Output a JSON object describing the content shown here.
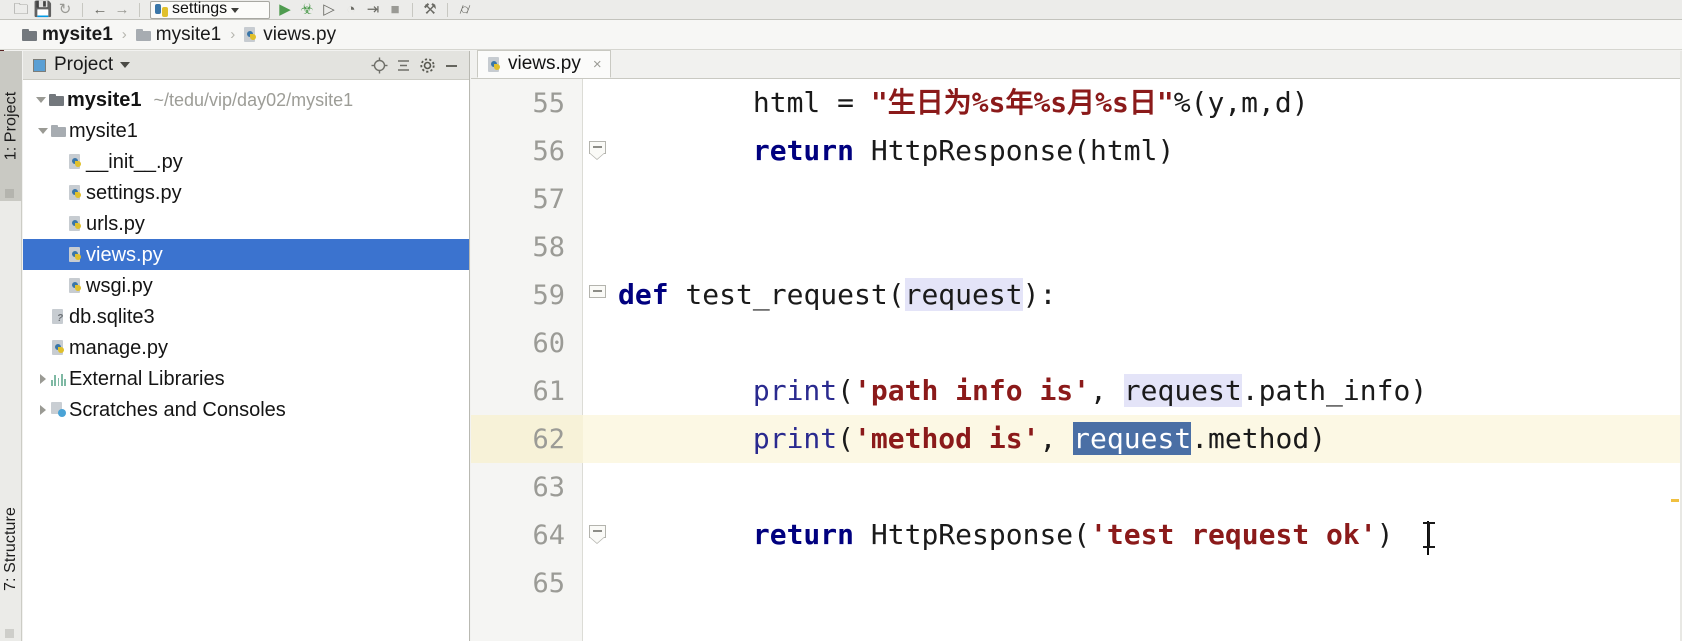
{
  "toolbar": {
    "icons": [
      {
        "name": "open-folder-icon",
        "glyph": "▭"
      },
      {
        "name": "save-all-icon",
        "glyph": "▣"
      },
      {
        "name": "sync-icon",
        "glyph": "↻"
      },
      {
        "name": "back-icon",
        "glyph": "←"
      },
      {
        "name": "forward-icon",
        "glyph": "→"
      }
    ],
    "run_config": {
      "label": "settings",
      "icon": "python-config-icon"
    },
    "run_icons": [
      {
        "name": "run-icon",
        "glyph": "▶"
      },
      {
        "name": "debug-icon",
        "glyph": "☣"
      },
      {
        "name": "run-coverage-icon",
        "glyph": "▷"
      },
      {
        "name": "profile-icon",
        "glyph": "◔"
      },
      {
        "name": "run-with-console-icon",
        "glyph": "⇥"
      },
      {
        "name": "stop-icon",
        "glyph": "■"
      },
      {
        "name": "build-icon",
        "glyph": "⚒"
      },
      {
        "name": "search-icon",
        "glyph": "⌕"
      }
    ]
  },
  "breadcrumb": {
    "items": [
      {
        "label": "mysite1",
        "icon": "folder-icon",
        "bold": true
      },
      {
        "label": "mysite1",
        "icon": "folder-icon-light",
        "bold": false
      },
      {
        "label": "views.py",
        "icon": "python-file-icon",
        "bold": false
      }
    ],
    "separator": "›"
  },
  "left_strip": {
    "project_tab": "1: Project",
    "structure_tab": "7: Structure"
  },
  "project_panel": {
    "title": "Project",
    "header_icons": [
      {
        "name": "locate-target-icon"
      },
      {
        "name": "collapse-all-icon"
      },
      {
        "name": "settings-gear-icon"
      },
      {
        "name": "hide-panel-icon"
      }
    ],
    "tree": [
      {
        "label": "mysite1",
        "path": "~/tedu/vip/day02/mysite1",
        "icon": "folder-icon",
        "arrow": "down",
        "indent": 0,
        "bold": true,
        "selected": false
      },
      {
        "label": "mysite1",
        "path": "",
        "icon": "folder-icon-light",
        "arrow": "down",
        "indent": 1,
        "bold": false,
        "selected": false
      },
      {
        "label": "__init__.py",
        "path": "",
        "icon": "python-file-icon",
        "arrow": "none",
        "indent": 3,
        "bold": false,
        "selected": false
      },
      {
        "label": "settings.py",
        "path": "",
        "icon": "python-file-icon",
        "arrow": "none",
        "indent": 3,
        "bold": false,
        "selected": false
      },
      {
        "label": "urls.py",
        "path": "",
        "icon": "python-file-icon",
        "arrow": "none",
        "indent": 3,
        "bold": false,
        "selected": false
      },
      {
        "label": "views.py",
        "path": "",
        "icon": "python-file-icon",
        "arrow": "none",
        "indent": 3,
        "bold": false,
        "selected": true
      },
      {
        "label": "wsgi.py",
        "path": "",
        "icon": "python-file-icon",
        "arrow": "none",
        "indent": 3,
        "bold": false,
        "selected": false
      },
      {
        "label": "db.sqlite3",
        "path": "",
        "icon": "database-file-icon",
        "arrow": "none",
        "indent": 2,
        "bold": false,
        "selected": false
      },
      {
        "label": "manage.py",
        "path": "",
        "icon": "python-file-icon",
        "arrow": "none",
        "indent": 2,
        "bold": false,
        "selected": false
      },
      {
        "label": "External Libraries",
        "path": "",
        "icon": "library-icon",
        "arrow": "right",
        "indent": 1,
        "bold": false,
        "selected": false
      },
      {
        "label": "Scratches and Consoles",
        "path": "",
        "icon": "scratch-icon",
        "arrow": "right",
        "indent": 1,
        "bold": false,
        "selected": false
      }
    ]
  },
  "editor": {
    "tab": {
      "label": "views.py",
      "icon": "python-file-icon",
      "close": "×"
    },
    "lines": [
      {
        "number": "55",
        "fold": "none",
        "highlight": false,
        "tokens": [
          {
            "t": "        ",
            "c": "plain"
          },
          {
            "t": "html",
            "c": "plain"
          },
          {
            "t": " = ",
            "c": "plain"
          },
          {
            "t": "\"生日为%s年%s月%s日\"",
            "c": "str"
          },
          {
            "t": "%(y,m,d)",
            "c": "plain"
          }
        ]
      },
      {
        "number": "56",
        "fold": "square",
        "highlight": false,
        "tokens": [
          {
            "t": "        ",
            "c": "plain"
          },
          {
            "t": "return",
            "c": "kw"
          },
          {
            "t": " HttpResponse(html)",
            "c": "plain"
          }
        ]
      },
      {
        "number": "57",
        "fold": "none",
        "highlight": false,
        "tokens": []
      },
      {
        "number": "58",
        "fold": "none",
        "highlight": false,
        "tokens": []
      },
      {
        "number": "59",
        "fold": "arrow",
        "highlight": false,
        "tokens": [
          {
            "t": "def",
            "c": "kw"
          },
          {
            "t": " test_request(",
            "c": "plain"
          },
          {
            "t": "request",
            "c": "hl-soft"
          },
          {
            "t": "):",
            "c": "plain"
          }
        ]
      },
      {
        "number": "60",
        "fold": "none",
        "highlight": false,
        "tokens": []
      },
      {
        "number": "61",
        "fold": "none",
        "highlight": false,
        "tokens": [
          {
            "t": "        ",
            "c": "plain"
          },
          {
            "t": "print",
            "c": "pr"
          },
          {
            "t": "(",
            "c": "plain"
          },
          {
            "t": "'path info is'",
            "c": "str"
          },
          {
            "t": ", ",
            "c": "plain"
          },
          {
            "t": "request",
            "c": "hl-soft"
          },
          {
            "t": ".path_info)",
            "c": "plain"
          }
        ]
      },
      {
        "number": "62",
        "fold": "none",
        "highlight": true,
        "tokens": [
          {
            "t": "        ",
            "c": "plain"
          },
          {
            "t": "print",
            "c": "pr"
          },
          {
            "t": "(",
            "c": "plain"
          },
          {
            "t": "'method is'",
            "c": "str"
          },
          {
            "t": ", ",
            "c": "plain"
          },
          {
            "t": "request",
            "c": "hl-sel"
          },
          {
            "t": ".method)",
            "c": "plain"
          }
        ]
      },
      {
        "number": "63",
        "fold": "none",
        "highlight": false,
        "tokens": []
      },
      {
        "number": "64",
        "fold": "square",
        "highlight": false,
        "tokens": [
          {
            "t": "        ",
            "c": "plain"
          },
          {
            "t": "return",
            "c": "kw"
          },
          {
            "t": " HttpResponse(",
            "c": "plain"
          },
          {
            "t": "'test request ok'",
            "c": "str"
          },
          {
            "t": ")",
            "c": "plain"
          }
        ]
      },
      {
        "number": "65",
        "fold": "none",
        "highlight": false,
        "tokens": []
      }
    ]
  },
  "colors": {
    "selection_blue": "#3b73cf",
    "token_selection": "#4a6fa5",
    "soft_highlight": "#e4e4f8",
    "current_line": "#fcf8e4",
    "keyword": "#00007f",
    "string": "#8b1a1a"
  }
}
